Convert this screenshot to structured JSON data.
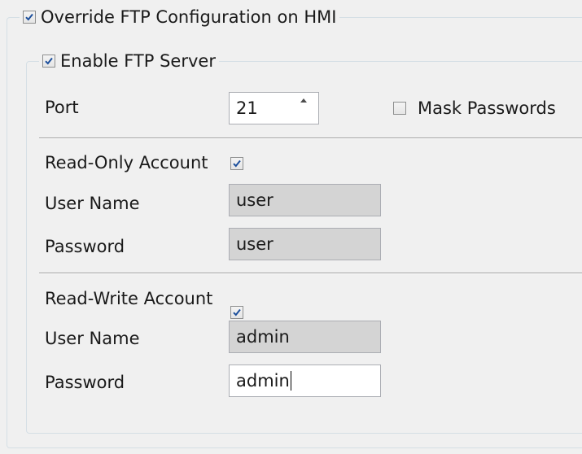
{
  "override": {
    "label": "Override FTP Configuration on HMI",
    "checked": true
  },
  "ftp_server": {
    "label": "Enable FTP Server",
    "checked": true
  },
  "port": {
    "label": "Port",
    "value": "21"
  },
  "mask_passwords": {
    "label": "Mask Passwords",
    "checked": false
  },
  "read_only": {
    "label": "Read-Only Account",
    "checked": true,
    "username_label": "User Name",
    "username_value": "user",
    "password_label": "Password",
    "password_value": "user"
  },
  "read_write": {
    "label": "Read-Write Account",
    "checked": true,
    "username_label": "User Name",
    "username_value": "admin",
    "password_label": "Password",
    "password_value": "admin"
  },
  "colors": {
    "checkmark": "#1c4f9c",
    "readonly_field": "#d4d4d4",
    "border": "#abadb3"
  }
}
